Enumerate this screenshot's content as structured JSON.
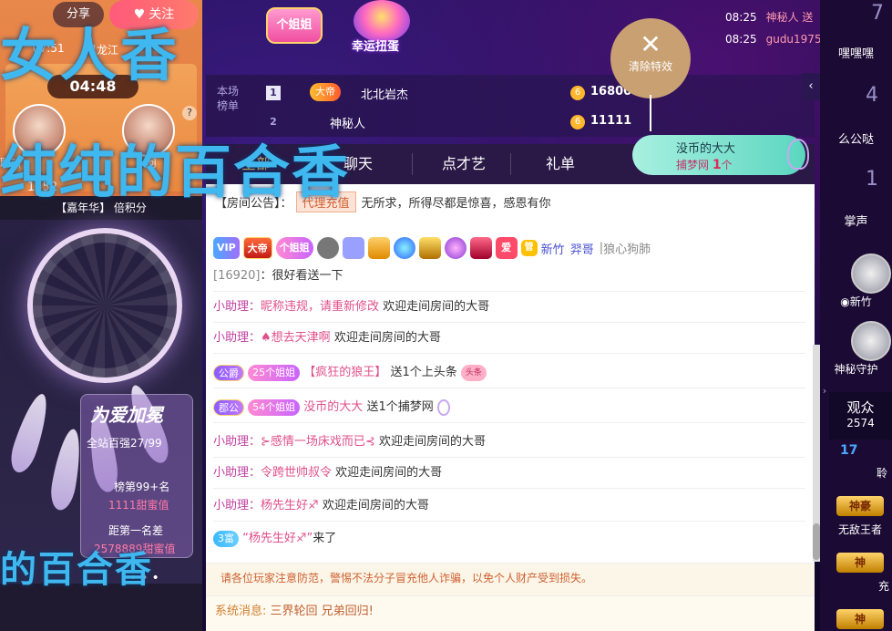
{
  "overlay_text": {
    "line1": "女人香",
    "line2": "纯纯的百合香",
    "line3": "的百合香"
  },
  "video": {
    "share_label": "分享",
    "follow_label": "关注",
    "live_time": "07:51",
    "host_name": "黑龙江",
    "timer": "04:48",
    "pk_left_name": "聆听",
    "pk_right_name": "河",
    "pk_score": "1452",
    "help_label": "?",
    "carnival": "【嘉年华】 倍积分",
    "rank_card": {
      "title": "为爱加冕",
      "site_rank": "全站百强27/99",
      "list_rank": "榜第99+名",
      "sweet_value": "1111甜蜜值",
      "gap_label": "距第一名差",
      "gap_value": "2578889甜蜜值"
    },
    "dots": "•••"
  },
  "header": {
    "girl_badge": "个姐姐",
    "gacha_label": "幸运扭蛋",
    "clear_effects": "清除特效",
    "clear_x": "✕",
    "feed": [
      {
        "time": "08:25",
        "name": "神秘人 送"
      },
      {
        "time": "08:25",
        "name": "gudu1975"
      }
    ]
  },
  "rank_board": {
    "tag_line1": "本场",
    "tag_line2": "榜单",
    "rows": [
      {
        "rank": "1",
        "crown": "大帝",
        "name": "北北岩杰",
        "coin": "6",
        "score": "16800"
      },
      {
        "rank": "2",
        "crown": "",
        "name": "神秘人",
        "coin": "6",
        "score": "11111"
      }
    ]
  },
  "tabs": [
    "全部",
    "聊天",
    "点才艺",
    "礼单"
  ],
  "gift_promo": {
    "line1": "没币的大大",
    "line2_prefix": "捕梦网 ",
    "line2_count": "1",
    "line2_suffix": "个"
  },
  "chat": {
    "announcement_label": "【房间公告】：",
    "announcement_tag": "代理充值",
    "announcement_text": "无所求，所得尽都是惊喜，感恩有你",
    "badges": {
      "vip": "VIP",
      "emperor": "大帝",
      "girl": "个姐姐",
      "guan": "管",
      "name1": "新竹",
      "name2": "羿哥",
      "sep": "|",
      "name3": "狼心狗肺"
    },
    "msg_id": "[16920]",
    "msg_id_text": "：很好看送一下",
    "lines": [
      {
        "who": "小助理：",
        "text1": "昵称违规，请重新修改",
        "text2": "欢迎走间房间的大哥"
      },
      {
        "who": "小助理：",
        "text1": "♠想去天津啊",
        "text2": "欢迎走间房间的大哥"
      },
      {
        "chip1": "公爵",
        "chip2": "25个姐姐",
        "user": "【疯狂的狼王】",
        "text": "送1个上头条",
        "tou": "头条"
      },
      {
        "chip1": "郡公",
        "chip2": "54个姐姐",
        "user": "没币的大大",
        "text": "送1个捕梦网"
      },
      {
        "who": "小助理：",
        "text1": "⊱感情一场床戏而已⊰",
        "text2": "欢迎走间房间的大哥"
      },
      {
        "who": "小助理：",
        "text1": "令跨世帅叔令",
        "text2": "欢迎走间房间的大哥"
      },
      {
        "who": "小助理：",
        "text1": "杨先生好♐",
        "text2": "欢迎走间房间的大哥"
      },
      {
        "chip1": "3富",
        "user": "“杨先生好♐”",
        "text": "来了"
      }
    ],
    "warning": "请各位玩家注意防范，警惕不法分子冒充他人诈骗，以免个人财产受到损失。",
    "system_label": "系统消息:",
    "system_text": " 三界轮回 兄弟回归!"
  },
  "right_panel": {
    "collapse": "‹",
    "items": [
      {
        "num": "7",
        "label": "嘿嘿嘿"
      },
      {
        "num": "4",
        "label": "么公哒"
      },
      {
        "num": "1",
        "label": "掌声"
      },
      {
        "label": "◉新竹"
      },
      {
        "label": "神秘守护"
      }
    ],
    "audience_label": "观众",
    "audience_count": "2574",
    "aud_rows": [
      {
        "text": "聆"
      },
      {
        "text": "无敌王者"
      },
      {
        "text": "充"
      }
    ],
    "god1": "神豪",
    "god2": "神",
    "god3": "神",
    "small_blue": "17"
  }
}
